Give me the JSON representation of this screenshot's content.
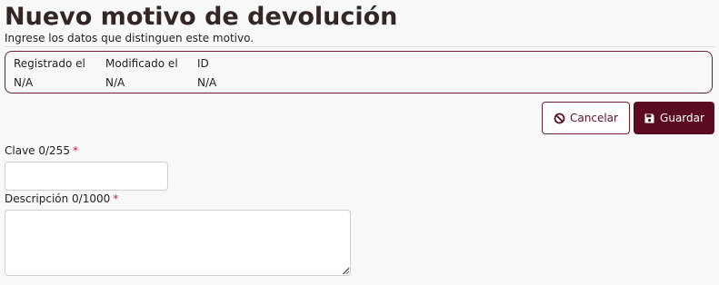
{
  "page": {
    "title": "Nuevo motivo de devolución",
    "subtitle": "Ingrese los datos que distinguen este motivo."
  },
  "metadata": {
    "columns": [
      {
        "label": "Registrado el",
        "value": "N/A"
      },
      {
        "label": "Modificado el",
        "value": "N/A"
      },
      {
        "label": "ID",
        "value": "N/A"
      }
    ]
  },
  "actions": {
    "cancel": {
      "label": "Cancelar",
      "icon": "ban-icon"
    },
    "save": {
      "label": "Guardar",
      "icon": "save-icon"
    }
  },
  "form": {
    "clave": {
      "label": "Clave 0/255",
      "required_mark": "*",
      "value": "",
      "placeholder": ""
    },
    "descripcion": {
      "label": "Descripción 0/1000",
      "required_mark": "*",
      "value": "",
      "placeholder": ""
    }
  },
  "colors": {
    "brand": "#5c0c22",
    "border_accent": "#6d2035",
    "required": "#d11b2b",
    "background": "#f8f8f8"
  }
}
